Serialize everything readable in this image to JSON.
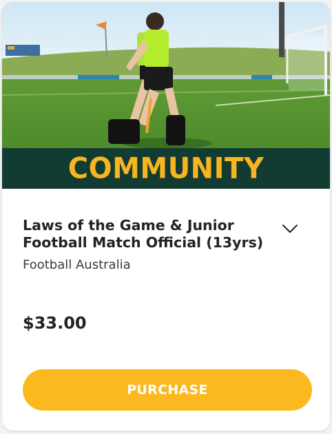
{
  "card": {
    "banner_label": "COMMUNITY",
    "course_title": "Laws of the Game & Junior Football Match Official (13yrs)",
    "provider": "Football Australia",
    "price": "$33.00",
    "purchase_label": "PURCHASE",
    "expand_icon": "chevron-down-icon"
  },
  "colors": {
    "banner_bg": "#123b32",
    "banner_text": "#f7b51f",
    "button_bg": "#fbb91f",
    "button_text": "#ffffff"
  }
}
